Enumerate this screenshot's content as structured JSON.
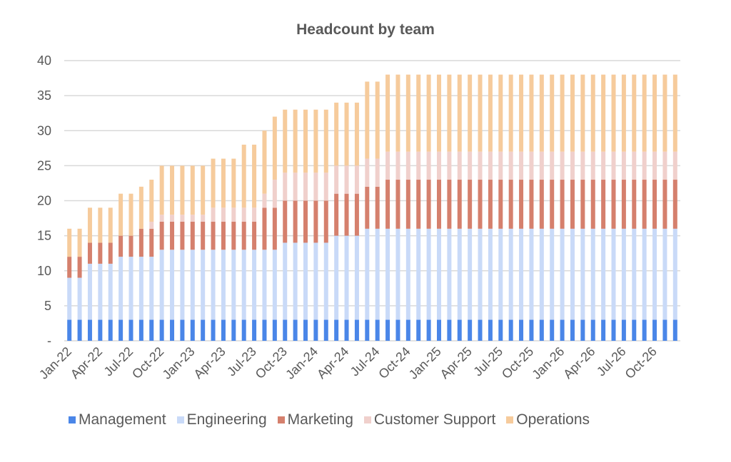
{
  "chart_data": {
    "type": "bar",
    "stacked": true,
    "title": "Headcount by team",
    "xlabel": "",
    "ylabel": "",
    "ylim": [
      0,
      40
    ],
    "y_ticks": [
      "-",
      "5",
      "10",
      "15",
      "20",
      "25",
      "30",
      "35",
      "40"
    ],
    "y_tick_values": [
      0,
      5,
      10,
      15,
      20,
      25,
      30,
      35,
      40
    ],
    "grid": true,
    "legend_position": "bottom",
    "x_tick_labels": [
      "Jan-22",
      "Apr-22",
      "Jul-22",
      "Oct-22",
      "Jan-23",
      "Apr-23",
      "Jul-23",
      "Oct-23",
      "Jan-24",
      "Apr-24",
      "Jul-24",
      "Oct-24",
      "Jan-25",
      "Apr-25",
      "Jul-25",
      "Oct-25",
      "Jan-26",
      "Apr-26",
      "Jul-26",
      "Oct-26"
    ],
    "categories": [
      "Jan-22",
      "Feb-22",
      "Mar-22",
      "Apr-22",
      "May-22",
      "Jun-22",
      "Jul-22",
      "Aug-22",
      "Sep-22",
      "Oct-22",
      "Nov-22",
      "Dec-22",
      "Jan-23",
      "Feb-23",
      "Mar-23",
      "Apr-23",
      "May-23",
      "Jun-23",
      "Jul-23",
      "Aug-23",
      "Sep-23",
      "Oct-23",
      "Nov-23",
      "Dec-23",
      "Jan-24",
      "Feb-24",
      "Mar-24",
      "Apr-24",
      "May-24",
      "Jun-24",
      "Jul-24",
      "Aug-24",
      "Sep-24",
      "Oct-24",
      "Nov-24",
      "Dec-24",
      "Jan-25",
      "Feb-25",
      "Mar-25",
      "Apr-25",
      "May-25",
      "Jun-25",
      "Jul-25",
      "Aug-25",
      "Sep-25",
      "Oct-25",
      "Nov-25",
      "Dec-25",
      "Jan-26",
      "Feb-26",
      "Mar-26",
      "Apr-26",
      "May-26",
      "Jun-26",
      "Jul-26",
      "Aug-26",
      "Sep-26",
      "Oct-26",
      "Nov-26",
      "Dec-26"
    ],
    "series": [
      {
        "name": "Management",
        "color": "#4a86e8",
        "values": [
          3,
          3,
          3,
          3,
          3,
          3,
          3,
          3,
          3,
          3,
          3,
          3,
          3,
          3,
          3,
          3,
          3,
          3,
          3,
          3,
          3,
          3,
          3,
          3,
          3,
          3,
          3,
          3,
          3,
          3,
          3,
          3,
          3,
          3,
          3,
          3,
          3,
          3,
          3,
          3,
          3,
          3,
          3,
          3,
          3,
          3,
          3,
          3,
          3,
          3,
          3,
          3,
          3,
          3,
          3,
          3,
          3,
          3,
          3,
          3
        ]
      },
      {
        "name": "Engineering",
        "color": "#c9daf8",
        "values": [
          6,
          6,
          8,
          8,
          8,
          9,
          9,
          9,
          9,
          10,
          10,
          10,
          10,
          10,
          10,
          10,
          10,
          10,
          10,
          10,
          10,
          11,
          11,
          11,
          11,
          11,
          12,
          12,
          12,
          13,
          13,
          13,
          13,
          13,
          13,
          13,
          13,
          13,
          13,
          13,
          13,
          13,
          13,
          13,
          13,
          13,
          13,
          13,
          13,
          13,
          13,
          13,
          13,
          13,
          13,
          13,
          13,
          13,
          13,
          13
        ]
      },
      {
        "name": "Marketing",
        "color": "#d5806d",
        "values": [
          3,
          3,
          3,
          3,
          3,
          3,
          3,
          4,
          4,
          4,
          4,
          4,
          4,
          4,
          4,
          4,
          4,
          4,
          4,
          6,
          6,
          6,
          6,
          6,
          6,
          6,
          6,
          6,
          6,
          6,
          6,
          7,
          7,
          7,
          7,
          7,
          7,
          7,
          7,
          7,
          7,
          7,
          7,
          7,
          7,
          7,
          7,
          7,
          7,
          7,
          7,
          7,
          7,
          7,
          7,
          7,
          7,
          7,
          7,
          7
        ]
      },
      {
        "name": "Customer Support",
        "color": "#f0d0cc",
        "values": [
          0,
          0,
          0,
          0,
          0,
          0,
          0,
          0,
          1,
          1,
          1,
          1,
          1,
          1,
          2,
          2,
          2,
          2,
          2,
          2,
          4,
          4,
          4,
          4,
          4,
          4,
          4,
          4,
          4,
          4,
          4,
          4,
          4,
          4,
          4,
          4,
          4,
          4,
          4,
          4,
          4,
          4,
          4,
          4,
          4,
          4,
          4,
          4,
          4,
          4,
          4,
          4,
          4,
          4,
          4,
          4,
          4,
          4,
          4,
          4
        ]
      },
      {
        "name": "Operations",
        "color": "#f6cb9c",
        "values": [
          4,
          4,
          5,
          5,
          5,
          6,
          6,
          6,
          6,
          7,
          7,
          7,
          7,
          7,
          7,
          7,
          7,
          9,
          9,
          9,
          9,
          9,
          9,
          9,
          9,
          9,
          9,
          9,
          9,
          11,
          11,
          11,
          11,
          11,
          11,
          11,
          11,
          11,
          11,
          11,
          11,
          11,
          11,
          11,
          11,
          11,
          11,
          11,
          11,
          11,
          11,
          11,
          11,
          11,
          11,
          11,
          11,
          11,
          11,
          11
        ]
      }
    ]
  },
  "colors": {
    "text": "#595959",
    "grid": "#d9d9d9"
  }
}
